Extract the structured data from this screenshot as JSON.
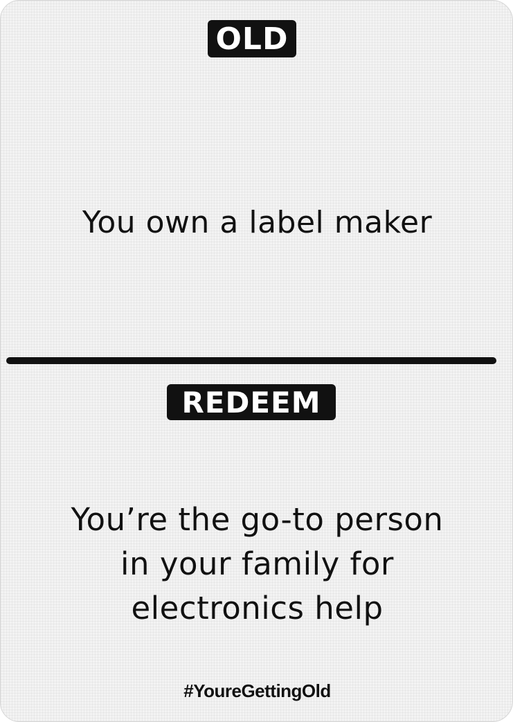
{
  "card": {
    "old_badge": "OLD",
    "old_text": "You own a label maker",
    "redeem_badge": "REDEEM",
    "redeem_lines": [
      "You’re the go-to person",
      "in your family for",
      "electronics help"
    ],
    "hashtag": "#YoureGettingOld"
  },
  "colors": {
    "ink": "#111111",
    "card_background": "#f3f3f3",
    "badge_text": "#ffffff"
  }
}
